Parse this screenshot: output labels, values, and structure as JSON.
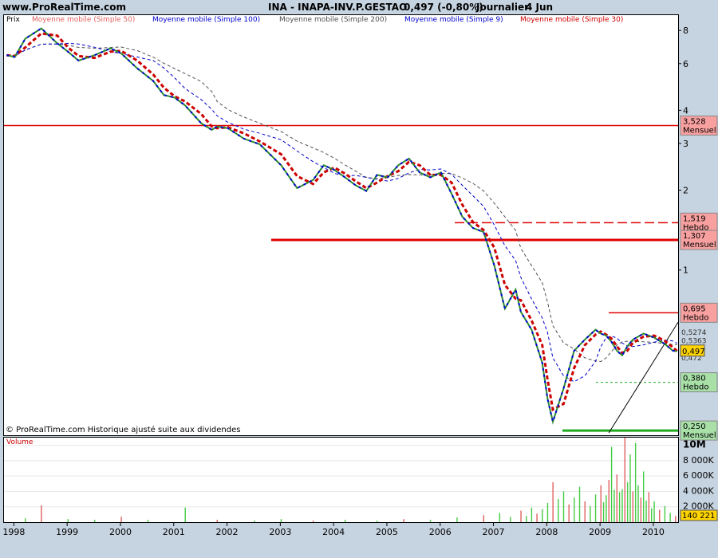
{
  "header": {
    "site": "www.ProRealTime.com",
    "instrument": "INA - INAPA-INV.P.GESTAO",
    "quote": "0,497 (-0,80%)",
    "period": "Journalier",
    "date": "4 Jun"
  },
  "legend": [
    {
      "label": "Prix",
      "color": "#000000"
    },
    {
      "label": "Moyenne mobile (Simple 50)",
      "color": "#E06060"
    },
    {
      "label": "Moyenne mobile (Simple 100)",
      "color": "#0000CC"
    },
    {
      "label": "Moyenne mobile (Simple 200)",
      "color": "#505050"
    },
    {
      "label": "Moyenne mobile (Simple 9)",
      "color": "#0000CC"
    },
    {
      "label": "Moyenne mobile (Simple 30)",
      "color": "#CC0000"
    }
  ],
  "footer_note": "© ProRealTime.com Historique ajusté suite aux dividendes",
  "volume_label": "Volume",
  "chart_data": [
    {
      "type": "line",
      "scale": "log",
      "ylim": [
        0.24,
        9.2
      ],
      "xlim": [
        1997.8,
        2010.45
      ],
      "y_ticks": [
        8,
        6,
        4,
        3,
        2,
        1
      ],
      "y_tick_labels": [
        "8",
        "6",
        "4",
        "3",
        "2",
        "1"
      ],
      "series": [
        {
          "name": "Prix",
          "x": [
            1997.85,
            1998.0,
            1998.2,
            1998.5,
            1998.8,
            1999.0,
            1999.2,
            1999.5,
            1999.8,
            2000.0,
            2000.3,
            2000.6,
            2000.8,
            2001.0,
            2001.2,
            2001.5,
            2001.7,
            2001.8,
            2002.0,
            2002.3,
            2002.6,
            2003.0,
            2003.3,
            2003.6,
            2003.8,
            2004.0,
            2004.2,
            2004.4,
            2004.6,
            2004.8,
            2005.0,
            2005.2,
            2005.4,
            2005.6,
            2005.8,
            2006.0,
            2006.2,
            2006.4,
            2006.6,
            2006.8,
            2007.0,
            2007.2,
            2007.4,
            2007.5,
            2007.7,
            2007.9,
            2008.0,
            2008.1,
            2008.3,
            2008.5,
            2008.7,
            2008.9,
            2009.0,
            2009.1,
            2009.2,
            2009.3,
            2009.4,
            2009.5,
            2009.6,
            2009.8,
            2010.0,
            2010.2,
            2010.35,
            2010.43
          ],
          "y": [
            6.5,
            6.4,
            7.5,
            8.2,
            7.2,
            6.7,
            6.2,
            6.5,
            6.9,
            6.6,
            5.8,
            5.2,
            4.6,
            4.5,
            4.2,
            3.6,
            3.4,
            3.5,
            3.45,
            3.15,
            3.0,
            2.5,
            2.05,
            2.2,
            2.5,
            2.4,
            2.25,
            2.1,
            2.0,
            2.3,
            2.25,
            2.5,
            2.65,
            2.35,
            2.25,
            2.35,
            1.95,
            1.6,
            1.45,
            1.4,
            1.05,
            0.72,
            0.85,
            0.7,
            0.6,
            0.45,
            0.33,
            0.27,
            0.36,
            0.5,
            0.55,
            0.6,
            0.58,
            0.57,
            0.54,
            0.5,
            0.48,
            0.52,
            0.55,
            0.58,
            0.56,
            0.53,
            0.5,
            0.497
          ]
        }
      ],
      "levels": [
        {
          "value": 3.528,
          "label": "3,528",
          "period": "Mensuel",
          "style": "solid"
        },
        {
          "value": 1.519,
          "label": "1,519",
          "period": "Hebdo",
          "style": "dashed"
        },
        {
          "value": 1.307,
          "label": "1,307",
          "period": "Mensuel",
          "style": "solid"
        },
        {
          "value": 0.695,
          "label": "0,695",
          "period": "Hebdo",
          "style": "solid"
        },
        {
          "value": 0.38,
          "label": "0,380",
          "period": "Hebdo",
          "style": "green"
        },
        {
          "value": 0.25,
          "label": "0,250",
          "period": "Mensuel",
          "style": "green"
        }
      ],
      "last_price": {
        "value": 0.497,
        "label": "0,497"
      },
      "small_labels": [
        "0,5274",
        "0,5363",
        "0,472"
      ]
    },
    {
      "type": "bar",
      "title": "Volume",
      "ylim": [
        0,
        11000000
      ],
      "y_ticks": [
        10000000,
        8000000,
        6000000,
        4000000,
        2000000
      ],
      "y_tick_labels": [
        "10M",
        "8 000K",
        "6 000K",
        "4 000K",
        "2 000K"
      ],
      "last_value_label": "140 221",
      "x_ticks": [
        1998,
        1999,
        2000,
        2001,
        2002,
        2003,
        2004,
        2005,
        2006,
        2007,
        2008,
        2009,
        2010
      ],
      "x_tick_labels": [
        "1998",
        "1999",
        "2000",
        "2001",
        "2002",
        "2003",
        "2004",
        "2005",
        "2006",
        "2007",
        "2008",
        "2009",
        "2010"
      ],
      "x": [
        1998.2,
        1998.5,
        1999.0,
        1999.5,
        2000.0,
        2000.5,
        2001.2,
        2001.8,
        2002.5,
        2003.0,
        2003.6,
        2004.2,
        2004.8,
        2005.3,
        2005.8,
        2006.3,
        2006.8,
        2007.1,
        2007.3,
        2007.5,
        2007.6,
        2007.7,
        2007.8,
        2007.9,
        2008.0,
        2008.1,
        2008.2,
        2008.3,
        2008.4,
        2008.5,
        2008.6,
        2008.7,
        2008.8,
        2008.9,
        2009.0,
        2009.05,
        2009.1,
        2009.15,
        2009.2,
        2009.25,
        2009.3,
        2009.35,
        2009.4,
        2009.45,
        2009.5,
        2009.55,
        2009.6,
        2009.65,
        2009.7,
        2009.75,
        2009.8,
        2009.85,
        2009.9,
        2009.95,
        2010.0,
        2010.1,
        2010.2,
        2010.3,
        2010.4
      ],
      "values": [
        500000,
        2200000,
        400000,
        300000,
        700000,
        300000,
        1900000,
        300000,
        200000,
        400000,
        200000,
        300000,
        200000,
        400000,
        300000,
        600000,
        900000,
        1200000,
        700000,
        1500000,
        800000,
        1900000,
        1100000,
        1700000,
        2500000,
        5200000,
        3000000,
        4000000,
        2300000,
        3200000,
        4600000,
        2700000,
        2100000,
        3600000,
        4800000,
        2600000,
        3500000,
        5500000,
        9800000,
        4200000,
        6200000,
        3900000,
        4300000,
        11200000,
        5200000,
        8800000,
        4000000,
        10300000,
        4800000,
        3200000,
        6600000,
        2800000,
        3900000,
        1800000,
        2700000,
        1600000,
        2100000,
        1200000,
        800000
      ]
    }
  ]
}
